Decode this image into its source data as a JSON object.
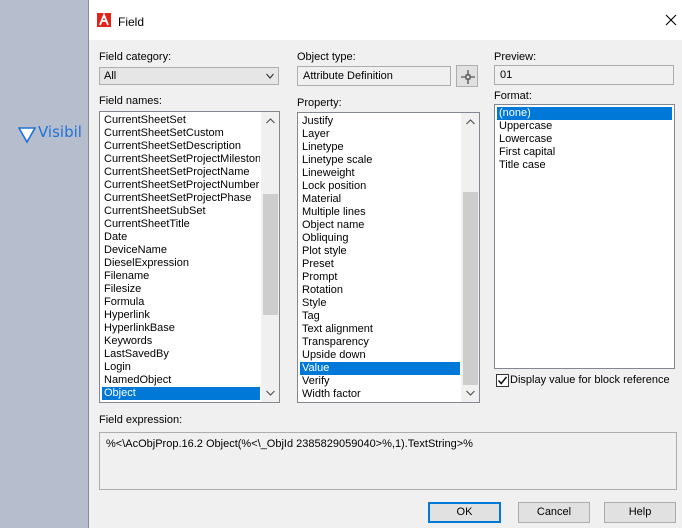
{
  "background": {
    "text": "Visibil"
  },
  "dialog": {
    "title": "Field",
    "field_category_label": "Field category:",
    "field_category_value": "All",
    "field_names_label": "Field names:",
    "field_names": [
      "CurrentSheetSet",
      "CurrentSheetSetCustom",
      "CurrentSheetSetDescription",
      "CurrentSheetSetProjectMilestone",
      "CurrentSheetSetProjectName",
      "CurrentSheetSetProjectNumber",
      "CurrentSheetSetProjectPhase",
      "CurrentSheetSubSet",
      "CurrentSheetTitle",
      "Date",
      "DeviceName",
      "DieselExpression",
      "Filename",
      "Filesize",
      "Formula",
      "Hyperlink",
      "HyperlinkBase",
      "Keywords",
      "LastSavedBy",
      "Login",
      "NamedObject",
      "Object"
    ],
    "field_names_selected": "Object",
    "object_type_label": "Object type:",
    "object_type_value": "Attribute Definition",
    "property_label": "Property:",
    "properties": [
      "Justify",
      "Layer",
      "Linetype",
      "Linetype scale",
      "Lineweight",
      "Lock position",
      "Material",
      "Multiple lines",
      "Object name",
      "Obliquing",
      "Plot style",
      "Preset",
      "Prompt",
      "Rotation",
      "Style",
      "Tag",
      "Text alignment",
      "Transparency",
      "Upside down",
      "Value",
      "Verify",
      "Width factor"
    ],
    "property_selected": "Value",
    "preview_label": "Preview:",
    "preview_value": "01",
    "format_label": "Format:",
    "formats": [
      "(none)",
      "Uppercase",
      "Lowercase",
      "First capital",
      "Title case"
    ],
    "format_selected": "(none)",
    "display_block_ref_label": "Display value for block reference",
    "display_block_ref_checked": true,
    "field_expression_label": "Field expression:",
    "field_expression_value": "%<\\AcObjProp.16.2 Object(%<\\_ObjId 2385829059040>%,1).TextString>%",
    "ok_label": "OK",
    "cancel_label": "Cancel",
    "help_label": "Help"
  },
  "colors": {
    "accent": "#0078d7",
    "brand_icon": "#e2231a"
  }
}
